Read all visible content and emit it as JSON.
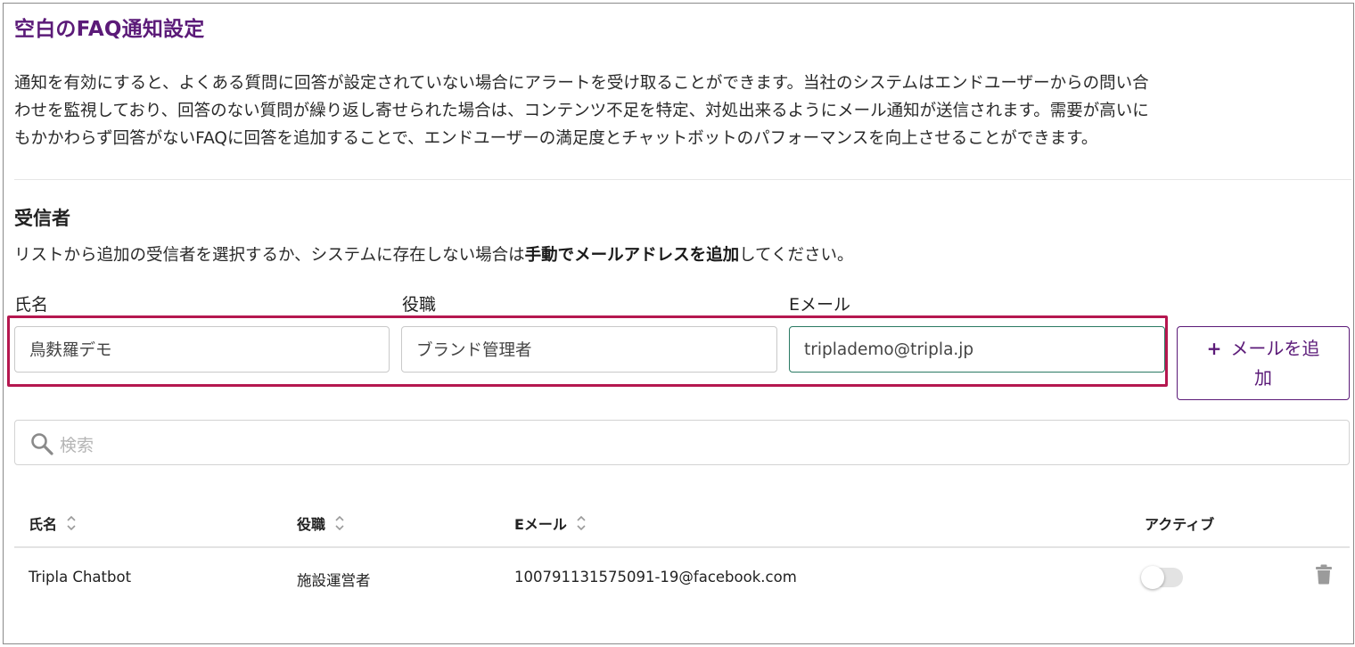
{
  "page": {
    "title": "空白のFAQ通知設定",
    "description_lines": [
      "通知を有効にすると、よくある質問に回答が設定されていない場合にアラートを受け取ることができます。当社のシステムはエンドユーザーからの問い合",
      "わせを監視しており、回答のない質問が繰り返し寄せられた場合は、コンテンツ不足を特定、対処出来るようにメール通知が送信されます。需要が高いに",
      "もかかわらず回答がないFAQに回答を追加することで、エンドユーザーの満足度とチャットボットのパフォーマンスを向上させることができます。"
    ]
  },
  "recipients": {
    "heading": "受信者",
    "instruction_prefix": "リストから追加の受信者を選択するか、システムに存在しない場合は",
    "instruction_bold": "手動でメールアドレスを追加",
    "instruction_suffix": "してください。"
  },
  "form": {
    "name_label": "氏名",
    "role_label": "役職",
    "email_label": "Eメール",
    "name_value": "鳥麩羅デモ",
    "role_value": "ブランド管理者",
    "email_value": "tripla​demo@tripla.jp",
    "add_button_plus": "+",
    "add_button_label_line1": "メールを追",
    "add_button_label_line2": "加"
  },
  "search": {
    "placeholder": "検索",
    "icon": "search-icon"
  },
  "table": {
    "columns": {
      "name": "氏名",
      "role": "役職",
      "email": "Eメール",
      "active": "アクティブ"
    },
    "rows": [
      {
        "name": "Tripla Chatbot",
        "role": "施設運営者",
        "email": "100791131575091-19@facebook.com",
        "active": false
      }
    ]
  },
  "colors": {
    "title": "#5b1a78",
    "highlight": "#b5174f",
    "focus_border": "#2b7a63",
    "button": "#5b1a78"
  }
}
